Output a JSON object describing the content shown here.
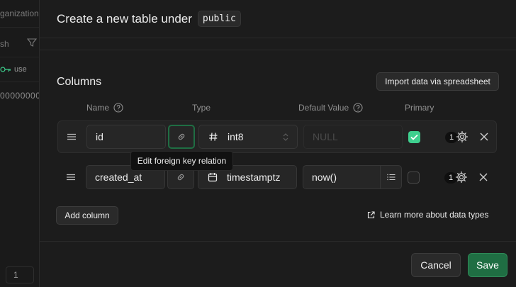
{
  "background": {
    "org_text": "ganization",
    "refresh_text": "sh",
    "user_text": "use",
    "id_text": "00000000",
    "page_number": "1"
  },
  "header": {
    "title": "Create a new table under",
    "schema": "public"
  },
  "columns_section": {
    "title": "Columns",
    "import_label": "Import data via spreadsheet",
    "headers": {
      "name": "Name",
      "type": "Type",
      "default_value": "Default Value",
      "primary": "Primary"
    },
    "rows": [
      {
        "name": "id",
        "type": "int8",
        "type_icon": "hash-icon",
        "default_value": "NULL",
        "primary": true,
        "badge": "1"
      },
      {
        "name": "created_at",
        "type": "timestamptz",
        "type_icon": "calendar-icon",
        "default_value": "now()",
        "primary": false,
        "badge": "1"
      }
    ],
    "tooltip": "Edit foreign key relation",
    "add_column_label": "Add column",
    "learn_more_label": "Learn more about data types"
  },
  "footer": {
    "cancel_label": "Cancel",
    "save_label": "Save"
  },
  "colors": {
    "accent": "#3ecf8e",
    "save_bg": "#1f6e43",
    "panel_bg": "#1c1c1c"
  }
}
